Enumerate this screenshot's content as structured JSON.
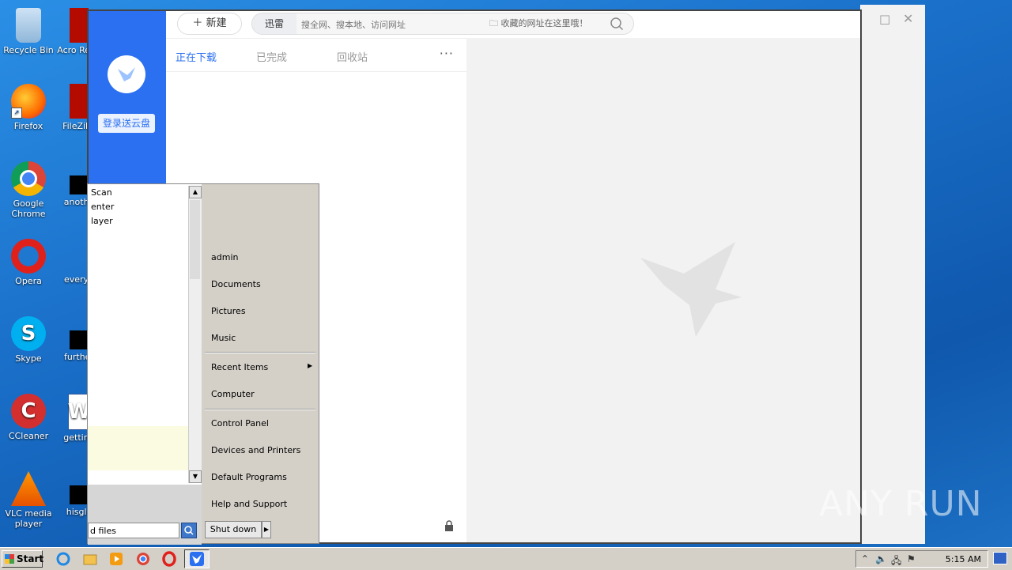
{
  "desktop": {
    "icons_left": [
      {
        "label": "Recycle Bin"
      },
      {
        "label": "Firefox"
      },
      {
        "label": "Google Chrome"
      },
      {
        "label": "Opera"
      },
      {
        "label": "Skype"
      },
      {
        "label": "CCleaner"
      },
      {
        "label": "VLC media player"
      }
    ],
    "icons_second": [
      {
        "label": "Acro Read"
      },
      {
        "label": "FileZilla"
      },
      {
        "label": "anothe"
      },
      {
        "label": "everyn"
      },
      {
        "label": "further"
      },
      {
        "label": "getting"
      },
      {
        "label": "hisglo"
      }
    ]
  },
  "xunlei": {
    "new_button": "新建",
    "search_brand": "迅雷",
    "search_placeholder": "搜全网、搜本地、访问网址",
    "favorites_hint": "收藏的网址在这里哦！",
    "login_button": "登录送云盘",
    "tabs": [
      {
        "label": "正在下载",
        "active": true
      },
      {
        "label": "已完成",
        "active": false
      },
      {
        "label": "回收站",
        "active": false
      }
    ],
    "more": "···",
    "accent": "#2b70f0"
  },
  "start_menu": {
    "left_items": [
      "Scan",
      "enter",
      "layer"
    ],
    "search_value": "d files",
    "right_items": {
      "user": "admin",
      "documents": "Documents",
      "pictures": "Pictures",
      "music": "Music",
      "recent": "Recent Items",
      "computer": "Computer",
      "control_panel": "Control Panel",
      "devices": "Devices and Printers",
      "defaults": "Default Programs",
      "help": "Help and Support"
    },
    "shutdown": "Shut down"
  },
  "taskbar": {
    "start_label": "Start",
    "clock": "5:15 AM"
  },
  "watermark": "ANY RUN"
}
